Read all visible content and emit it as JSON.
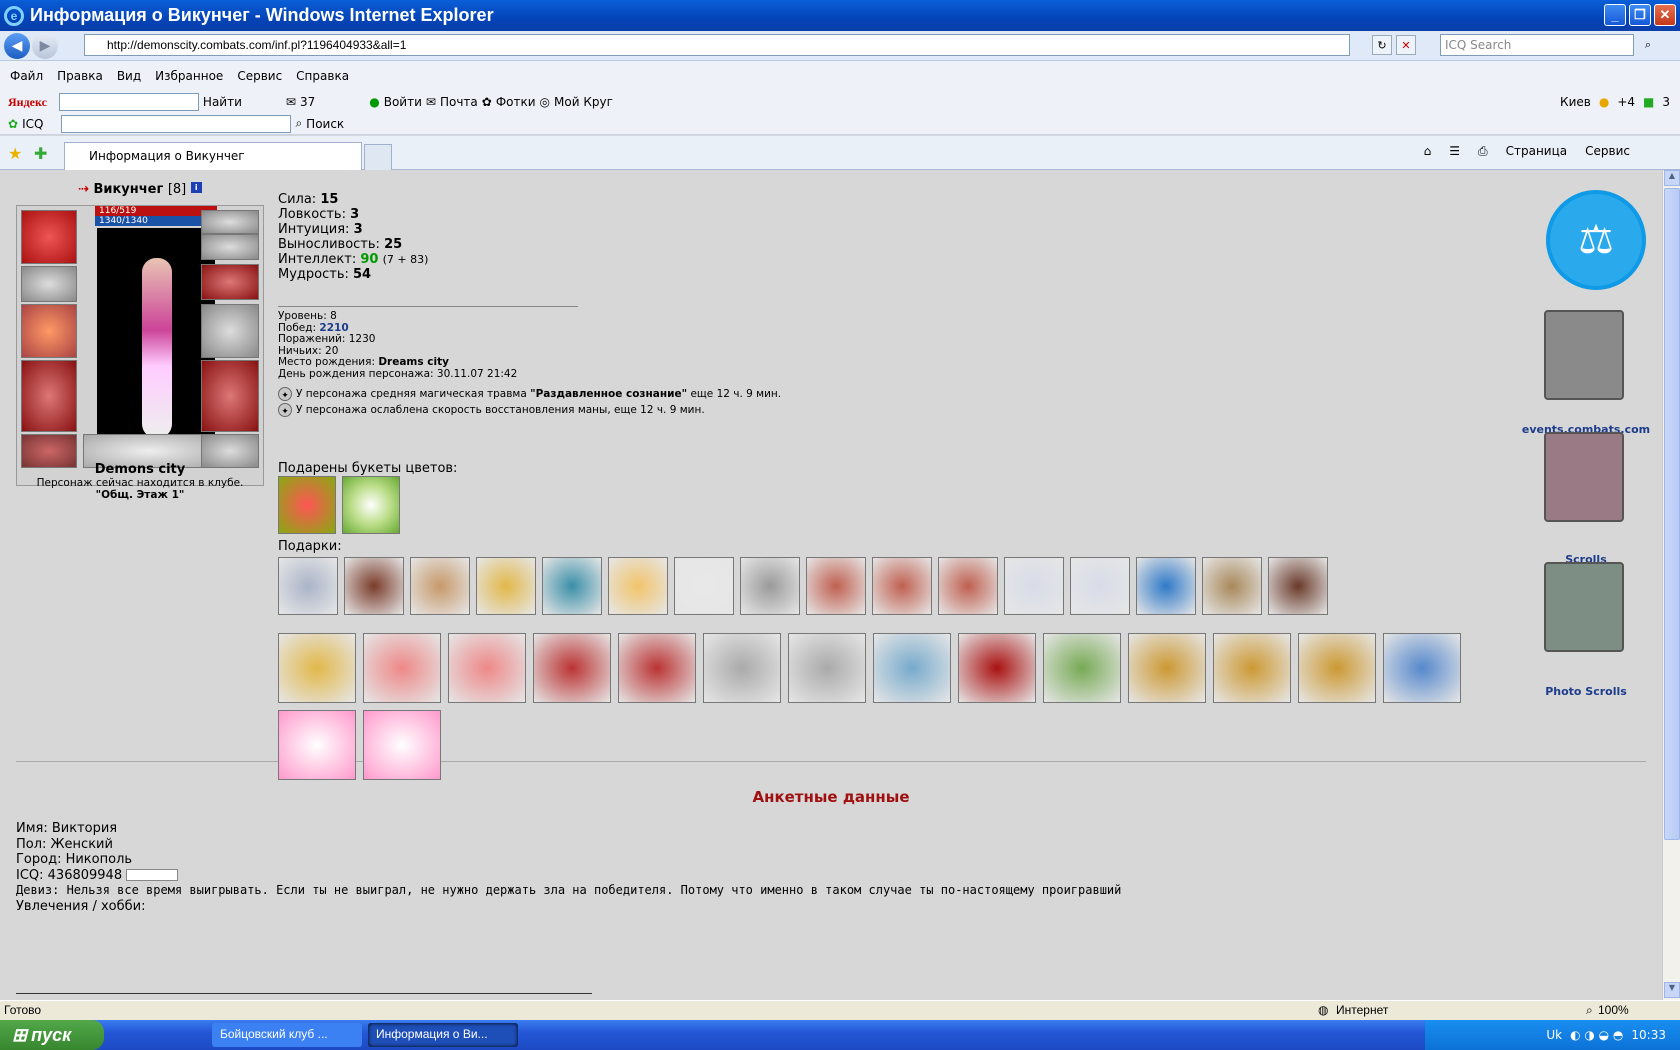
{
  "window": {
    "title": "Информация о Викунчег - Windows Internet Explorer"
  },
  "address": {
    "url": "http://demonscity.combats.com/inf.pl?1196404933&all=1",
    "search_placeholder": "ICQ Search"
  },
  "menu": [
    "Файл",
    "Правка",
    "Вид",
    "Избранное",
    "Сервис",
    "Справка"
  ],
  "yandex_bar": {
    "brand": "Яндекс",
    "find": "Найти",
    "mail_count": "37",
    "enter": "Войти",
    "mail": "Почта",
    "photos": "Фотки",
    "circle": "Мой Круг",
    "city": "Киев",
    "temp": "+4",
    "count": "3"
  },
  "icq_bar": {
    "icq": "ICQ",
    "search": "Поиск"
  },
  "tab": {
    "label": "Информация о Викунчег"
  },
  "cmdbar": {
    "page": "Страница",
    "service": "Сервис"
  },
  "character": {
    "name": "Викунчег",
    "level_bracket": "[8]",
    "hp": "116/519",
    "mana": "1340/1340",
    "city": "Demons city",
    "location_text": "Персонаж сейчас находится в клубе.",
    "location_room": "\"Общ. Этаж 1\""
  },
  "stats": [
    {
      "label": "Сила:",
      "value": "15",
      "extra": ""
    },
    {
      "label": "Ловкость:",
      "value": "3",
      "extra": ""
    },
    {
      "label": "Интуиция:",
      "value": "3",
      "extra": ""
    },
    {
      "label": "Выносливость:",
      "value": "25",
      "extra": ""
    },
    {
      "label": "Интеллект:",
      "value": "90",
      "extra": "(7 + 83)"
    },
    {
      "label": "Мудрость:",
      "value": "54",
      "extra": ""
    }
  ],
  "details": {
    "level": "Уровень: 8",
    "wins_label": "Побед:",
    "wins": "2210",
    "losses": "Поражений: 1230",
    "draws": "Ничьих: 20",
    "birthplace_label": "Место рождения:",
    "birthplace": "Dreams city",
    "birthday": "День рождения персонажа: 30.11.07 21:42"
  },
  "effects": [
    {
      "pre": "У персонажа средняя магическая травма",
      "bold": "\"Раздавленное сознание\"",
      "post": "еще 12 ч. 9 мин."
    },
    {
      "pre": "У персонажа ослаблена скорость восстановления маны, еще 12 ч. 9 мин.",
      "bold": "",
      "post": ""
    }
  ],
  "flowers_label": "Подарены букеты цветов:",
  "gifts_label": "Подарки:",
  "side": {
    "events": "events.combats.com",
    "scrolls": "Scrolls",
    "photo": "Photo Scrolls"
  },
  "profile": {
    "title": "Анкетные данные",
    "name": "Имя: Виктория",
    "sex": "Пол: Женский",
    "city": "Город: Никополь",
    "icq": "ICQ: 436809948",
    "motto": "Девиз: Нельзя все время выигрывать. Если ты не выиграл, не нужно держать зла на победителя. Потому что именно в таком случае ты по-настоящему проигравший",
    "hobby": "Увлечения / хобби:"
  },
  "status": {
    "ready": "Готово",
    "zone": "Интернет",
    "zoom": "100%"
  },
  "taskbar": {
    "start": "пуск",
    "task1": "Бойцовский клуб ...",
    "task2": "Информация о Ви...",
    "lang": "Uk",
    "time": "10:33"
  }
}
